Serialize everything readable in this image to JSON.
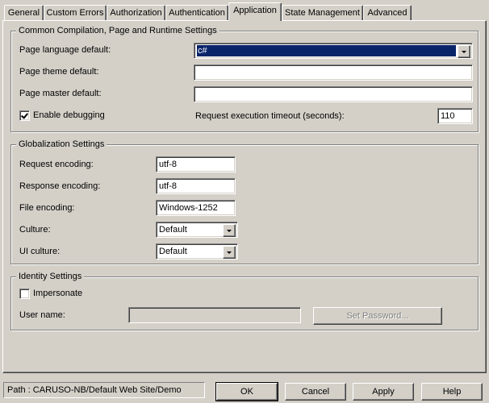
{
  "tabs": [
    {
      "label": "General"
    },
    {
      "label": "Custom Errors"
    },
    {
      "label": "Authorization"
    },
    {
      "label": "Authentication"
    },
    {
      "label": "Application",
      "active": true
    },
    {
      "label": "State Management"
    },
    {
      "label": "Advanced"
    }
  ],
  "compilation": {
    "title": "Common Compilation, Page and Runtime Settings",
    "page_language_label": "Page language default:",
    "page_language_value": "c#",
    "page_theme_label": "Page theme default:",
    "page_theme_value": "",
    "page_master_label": "Page master default:",
    "page_master_value": "",
    "enable_debugging_label": "Enable debugging",
    "enable_debugging_checked": true,
    "timeout_label": "Request execution timeout (seconds):",
    "timeout_value": "110"
  },
  "globalization": {
    "title": "Globalization Settings",
    "request_encoding_label": "Request encoding:",
    "request_encoding_value": "utf-8",
    "response_encoding_label": "Response encoding:",
    "response_encoding_value": "utf-8",
    "file_encoding_label": "File encoding:",
    "file_encoding_value": "Windows-1252",
    "culture_label": "Culture:",
    "culture_value": "Default",
    "ui_culture_label": "UI culture:",
    "ui_culture_value": "Default"
  },
  "identity": {
    "title": "Identity Settings",
    "impersonate_label": "Impersonate",
    "impersonate_checked": false,
    "user_name_label": "User name:",
    "user_name_value": "",
    "set_password_label": "Set Password..."
  },
  "footer": {
    "path": "Path : CARUSO-NB/Default Web Site/Demo",
    "ok_label": "OK",
    "cancel_label": "Cancel",
    "apply_label": "Apply",
    "help_label": "Help"
  },
  "colors": {
    "face": "#d4d0c8",
    "selection": "#0a246a"
  }
}
